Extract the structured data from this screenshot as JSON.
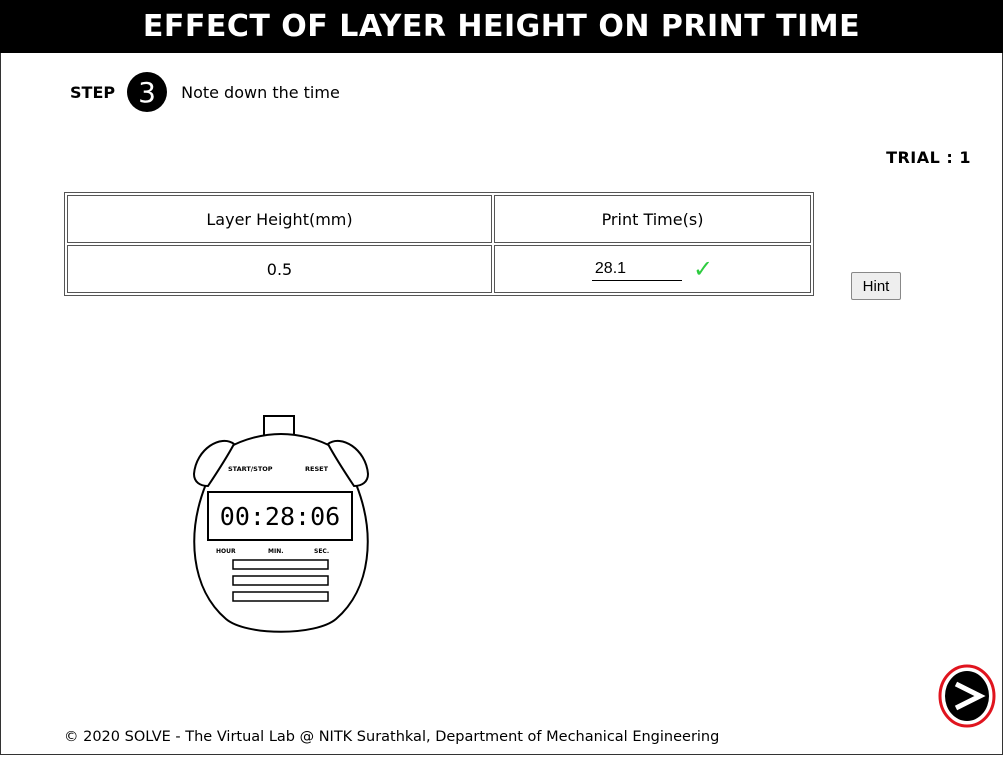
{
  "header": {
    "title": "EFFECT OF LAYER HEIGHT ON PRINT TIME"
  },
  "step": {
    "label": "STEP",
    "number": "3",
    "instruction": "Note down the time"
  },
  "trial": {
    "text": "TRIAL : 1"
  },
  "table": {
    "headers": [
      "Layer Height(mm)",
      "Print Time(s)"
    ],
    "rows": [
      {
        "layer_height": "0.5",
        "print_time": "28.1",
        "status": "correct"
      }
    ]
  },
  "hint_button": {
    "label": "Hint"
  },
  "stopwatch": {
    "start_stop_label": "START/STOP",
    "reset_label": "RESET",
    "display": "00:28:06",
    "hour_label": "HOUR",
    "min_label": "MIN.",
    "sec_label": "SEC."
  },
  "footer": {
    "text": "© 2020 SOLVE - The Virtual Lab @ NITK Surathkal, Department of Mechanical Engineering"
  },
  "icons": {
    "check": "check-icon",
    "next": "next-arrow-icon"
  },
  "colors": {
    "check": "#2ecc40",
    "next_ring": "#e0141e"
  }
}
